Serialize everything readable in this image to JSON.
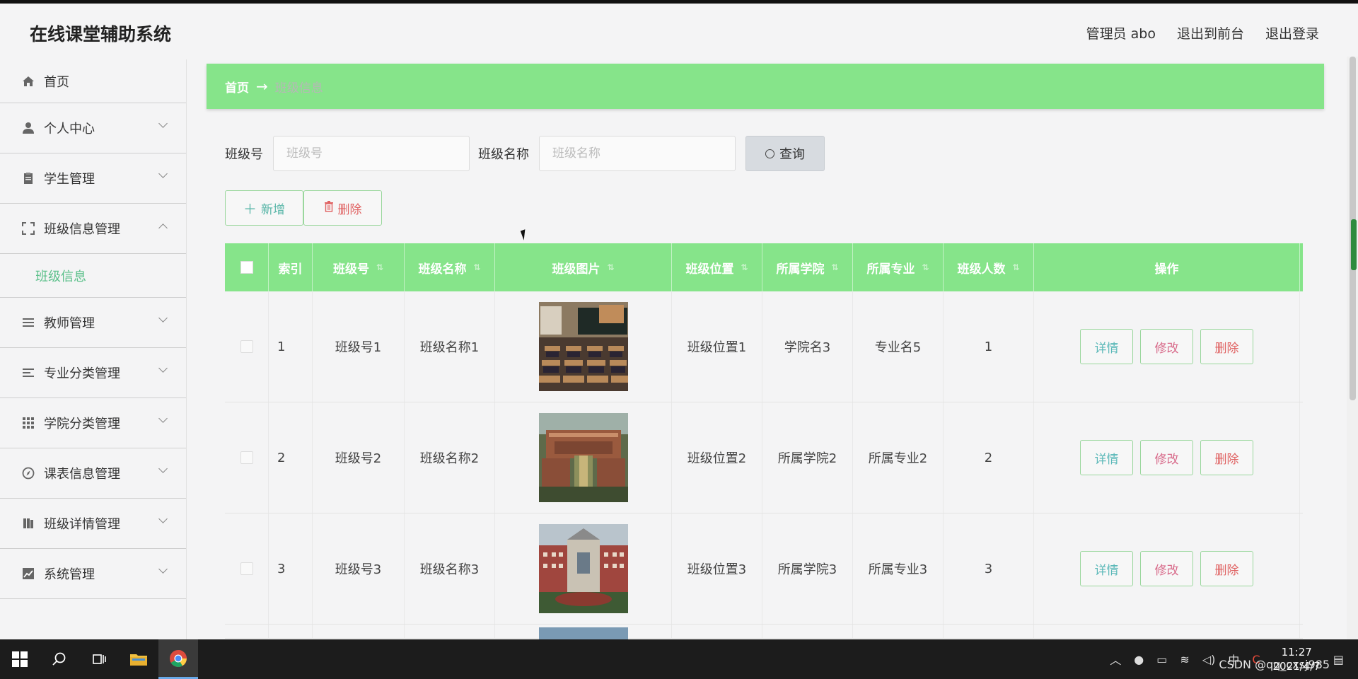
{
  "app": {
    "title": "在线课堂辅助系统"
  },
  "header": {
    "user_label": "管理员 abo",
    "front_link": "退出到前台",
    "logout_link": "退出登录"
  },
  "sidebar": {
    "items": [
      {
        "label": "首页",
        "icon": "home-icon"
      },
      {
        "label": "个人中心",
        "icon": "user-icon"
      },
      {
        "label": "学生管理",
        "icon": "clipboard-icon"
      },
      {
        "label": "班级信息管理",
        "icon": "fullscreen-icon",
        "expanded": true,
        "sub": [
          "班级信息"
        ]
      },
      {
        "label": "教师管理",
        "icon": "list-icon"
      },
      {
        "label": "专业分类管理",
        "icon": "menu-icon"
      },
      {
        "label": "学院分类管理",
        "icon": "grid-icon"
      },
      {
        "label": "课表信息管理",
        "icon": "compass-icon"
      },
      {
        "label": "班级详情管理",
        "icon": "book-icon"
      },
      {
        "label": "系统管理",
        "icon": "chart-icon"
      }
    ]
  },
  "breadcrumb": {
    "home": "首页",
    "arrow": "→",
    "current": "班级信息"
  },
  "search": {
    "class_no_label": "班级号",
    "class_no_placeholder": "班级号",
    "class_name_label": "班级名称",
    "class_name_placeholder": "班级名称",
    "query_label": "查询"
  },
  "actions": {
    "add_label": "新增",
    "delete_label": "删除"
  },
  "table": {
    "headers": [
      "索引",
      "班级号",
      "班级名称",
      "班级图片",
      "班级位置",
      "所属学院",
      "所属专业",
      "班级人数",
      "操作"
    ],
    "rows": [
      {
        "index": "1",
        "class_no": "班级号1",
        "class_name": "班级名称1",
        "location": "班级位置1",
        "college": "学院名3",
        "major": "专业名5",
        "count": "1"
      },
      {
        "index": "2",
        "class_no": "班级号2",
        "class_name": "班级名称2",
        "location": "班级位置2",
        "college": "所属学院2",
        "major": "所属专业2",
        "count": "2"
      },
      {
        "index": "3",
        "class_no": "班级号3",
        "class_name": "班级名称3",
        "location": "班级位置3",
        "college": "所属学院3",
        "major": "所属专业3",
        "count": "3"
      }
    ],
    "op_labels": {
      "detail": "详情",
      "edit": "修改",
      "remove": "删除"
    }
  },
  "taskbar": {
    "time": "11:27",
    "date": "2021/4/7",
    "ime": "中"
  },
  "watermark": "CSDN @qq_cxsj985",
  "colors": {
    "accent": "#86e48a",
    "sub_active": "#5bc08a",
    "delete": "#e06363"
  }
}
